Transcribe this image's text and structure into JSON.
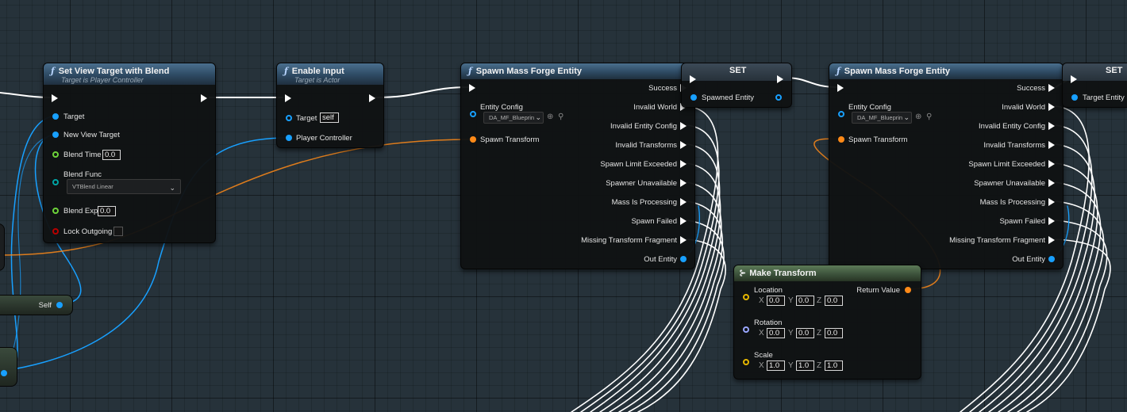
{
  "nodes": {
    "set_view_target": {
      "title": "Set View Target with Blend",
      "subtitle": "Target is Player Controller",
      "pins": {
        "target": "Target",
        "new_view_target": "New View Target",
        "blend_time": "Blend Time",
        "blend_time_value": "0.0",
        "blend_func": "Blend Func",
        "blend_func_value": "VTBlend Linear",
        "blend_exp": "Blend Exp",
        "blend_exp_value": "0.0",
        "lock_outgoing": "Lock Outgoing"
      }
    },
    "enable_input": {
      "title": "Enable Input",
      "subtitle": "Target is Actor",
      "pins": {
        "target": "Target",
        "target_value": "self",
        "player_controller": "Player Controller"
      }
    },
    "spawn_1": {
      "title": "Spawn Mass Forge Entity",
      "entity_config": "Entity Config",
      "entity_config_value": "DA_MF_Blueprin",
      "spawn_transform": "Spawn Transform",
      "outputs": [
        "Success",
        "Invalid World",
        "Invalid Entity Config",
        "Invalid Transforms",
        "Spawn Limit Exceeded",
        "Spawner Unavailable",
        "Mass Is Processing",
        "Spawn Failed",
        "Missing Transform Fragment",
        "Out Entity"
      ]
    },
    "set_1": {
      "title": "SET",
      "pin": "Spawned Entity"
    },
    "spawn_2": {
      "title": "Spawn Mass Forge Entity",
      "entity_config": "Entity Config",
      "entity_config_value": "DA_MF_Blueprin",
      "spawn_transform": "Spawn Transform",
      "outputs": [
        "Success",
        "Invalid World",
        "Invalid Entity Config",
        "Invalid Transforms",
        "Spawn Limit Exceeded",
        "Spawner Unavailable",
        "Mass Is Processing",
        "Spawn Failed",
        "Missing Transform Fragment",
        "Out Entity"
      ]
    },
    "set_2": {
      "title": "SET",
      "pin": "Target Entity"
    },
    "make_transform": {
      "title": "Make Transform",
      "location": "Location",
      "rotation": "Rotation",
      "scale": "Scale",
      "return_value": "Return Value",
      "axis_x": "X",
      "axis_y": "Y",
      "axis_z": "Z",
      "location_values": [
        "0.0",
        "0.0",
        "0.0"
      ],
      "rotation_values": [
        "0.0",
        "0.0",
        "0.0"
      ],
      "scale_values": [
        "1.0",
        "1.0",
        "1.0"
      ]
    },
    "self_node": {
      "label": "Self"
    }
  },
  "colors": {
    "object_pin": "#18a0ff",
    "struct_pin": "#ff8a18",
    "float_pin": "#6ed43a",
    "bool_pin": "#b80000",
    "enum_pin": "#00a5a5",
    "vector_pin": "#e5b600",
    "rotator_pin": "#9aa6ff",
    "exec_wire": "#ffffff"
  }
}
